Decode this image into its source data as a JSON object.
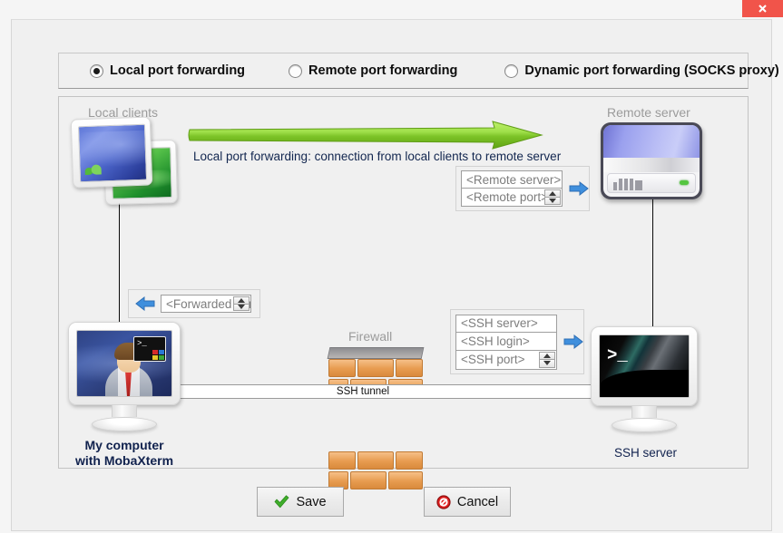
{
  "window": {
    "close_label": "×",
    "close_icon": "close-icon"
  },
  "modes": {
    "options": [
      {
        "label": "Local port forwarding",
        "selected": true
      },
      {
        "label": "Remote port forwarding",
        "selected": false
      },
      {
        "label": "Dynamic port forwarding (SOCKS proxy)",
        "selected": false
      }
    ]
  },
  "diagram": {
    "local_clients_label": "Local clients",
    "remote_server_label": "Remote server",
    "description": "Local port forwarding: connection from local clients to remote server",
    "firewall_label": "Firewall",
    "tunnel_label": "SSH tunnel",
    "my_computer_line1": "My computer",
    "my_computer_line2": "with MobaXterm",
    "ssh_server_label": "SSH server",
    "arrow_right_icon": "arrow-right-icon",
    "arrow_left_icon": "arrow-left-icon",
    "green_arrow_icon": "green-arrow-right-icon",
    "terminal_prompt": ">_"
  },
  "fields": {
    "remote_server": {
      "value": "",
      "placeholder": "<Remote server>"
    },
    "remote_port": {
      "value": "",
      "placeholder": "<Remote port>"
    },
    "forwarded_port": {
      "value": "",
      "placeholder": "<Forwarded port>"
    },
    "ssh_server": {
      "value": "",
      "placeholder": "<SSH server>"
    },
    "ssh_login": {
      "value": "",
      "placeholder": "<SSH login>"
    },
    "ssh_port": {
      "value": "",
      "placeholder": "<SSH port>"
    }
  },
  "buttons": {
    "save_label": "Save",
    "cancel_label": "Cancel",
    "save_icon": "green-check-icon",
    "cancel_icon": "red-prohibition-icon"
  },
  "colors": {
    "close_red": "#f1544a",
    "green_arrow": "#8dcf30",
    "tunnel_red": "#f10000",
    "brick_orange": "#e79b4f",
    "server_blue": "#9aa0ee",
    "led_green": "#54c540"
  }
}
